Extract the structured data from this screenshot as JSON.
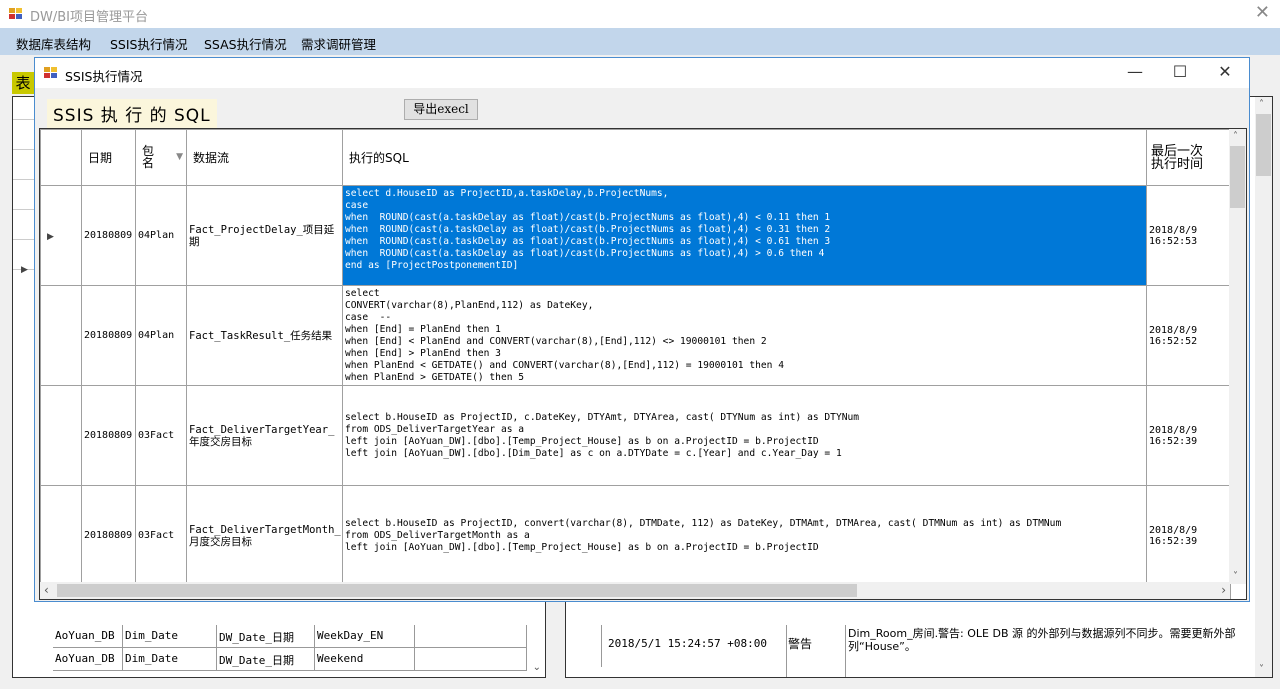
{
  "main_window": {
    "title": "DW/BI项目管理平台",
    "close_glyph": "✕",
    "menu": [
      "数据库表结构",
      "SSIS执行情况",
      "SSAS执行情况",
      "需求调研管理"
    ]
  },
  "background": {
    "badge": "表",
    "left_rows": [
      [
        "AoYuan_DB",
        "Dim_Date",
        "DW_Date_日期",
        "WeekDay_EN"
      ],
      [
        "AoYuan_DB",
        "Dim_Date",
        "DW_Date_日期",
        "Weekend"
      ]
    ],
    "right_row": {
      "time": "2018/5/1 15:24:57 +08:00",
      "level": "警告",
      "message": "Dim_Room_房间.警告: OLE DB 源 的外部列与数据源列不同步。需要更新外部列“House”。"
    }
  },
  "dialog": {
    "title": "SSIS执行情况",
    "heading": "SSIS 执 行 的 SQL",
    "export_label": "导出execl",
    "controls": {
      "minimize": "—",
      "maximize": "☐",
      "close": "✕"
    },
    "columns": [
      "日期",
      "包名",
      "数据流",
      "执行的SQL",
      "最后一次执行时间"
    ],
    "rows": [
      {
        "date": "20180809",
        "package": "04Plan",
        "dataflow": "Fact_ProjectDelay_项目延期",
        "sql": "select d.HouseID as ProjectID,a.taskDelay,b.ProjectNums,\ncase\nwhen  ROUND(cast(a.taskDelay as float)/cast(b.ProjectNums as float),4) < 0.11 then 1\nwhen  ROUND(cast(a.taskDelay as float)/cast(b.ProjectNums as float),4) < 0.31 then 2\nwhen  ROUND(cast(a.taskDelay as float)/cast(b.ProjectNums as float),4) < 0.61 then 3\nwhen  ROUND(cast(a.taskDelay as float)/cast(b.ProjectNums as float),4) > 0.6 then 4\nend as [ProjectPostponementID]",
        "last_run": "2018/8/9\n16:52:53",
        "selected": true
      },
      {
        "date": "20180809",
        "package": "04Plan",
        "dataflow": "Fact_TaskResult_任务结果",
        "sql": "select\nCONVERT(varchar(8),PlanEnd,112) as DateKey,\ncase  --\nwhen [End] = PlanEnd then 1\nwhen [End] < PlanEnd and CONVERT(varchar(8),[End],112) <> 19000101 then 2\nwhen [End] > PlanEnd then 3\nwhen PlanEnd < GETDATE() and CONVERT(varchar(8),[End],112) = 19000101 then 4\nwhen PlanEnd > GETDATE() then 5",
        "last_run": "2018/8/9\n16:52:52",
        "selected": false
      },
      {
        "date": "20180809",
        "package": "03Fact",
        "dataflow": "Fact_DeliverTargetYear_年度交房目标",
        "sql": "select b.HouseID as ProjectID, c.DateKey, DTYAmt, DTYArea, cast( DTYNum as int) as DTYNum\nfrom ODS_DeliverTargetYear as a\nleft join [AoYuan_DW].[dbo].[Temp_Project_House] as b on a.ProjectID = b.ProjectID\nleft join [AoYuan_DW].[dbo].[Dim_Date] as c on a.DTYDate = c.[Year] and c.Year_Day = 1",
        "last_run": "2018/8/9\n16:52:39",
        "selected": false
      },
      {
        "date": "20180809",
        "package": "03Fact",
        "dataflow": "Fact_DeliverTargetMonth_月度交房目标",
        "sql": "select b.HouseID as ProjectID, convert(varchar(8), DTMDate, 112) as DateKey, DTMAmt, DTMArea, cast( DTMNum as int) as DTMNum\nfrom ODS_DeliverTargetMonth as a\nleft join [AoYuan_DW].[dbo].[Temp_Project_House] as b on a.ProjectID = b.ProjectID",
        "last_run": "2018/8/9\n16:52:39",
        "selected": false
      }
    ]
  }
}
